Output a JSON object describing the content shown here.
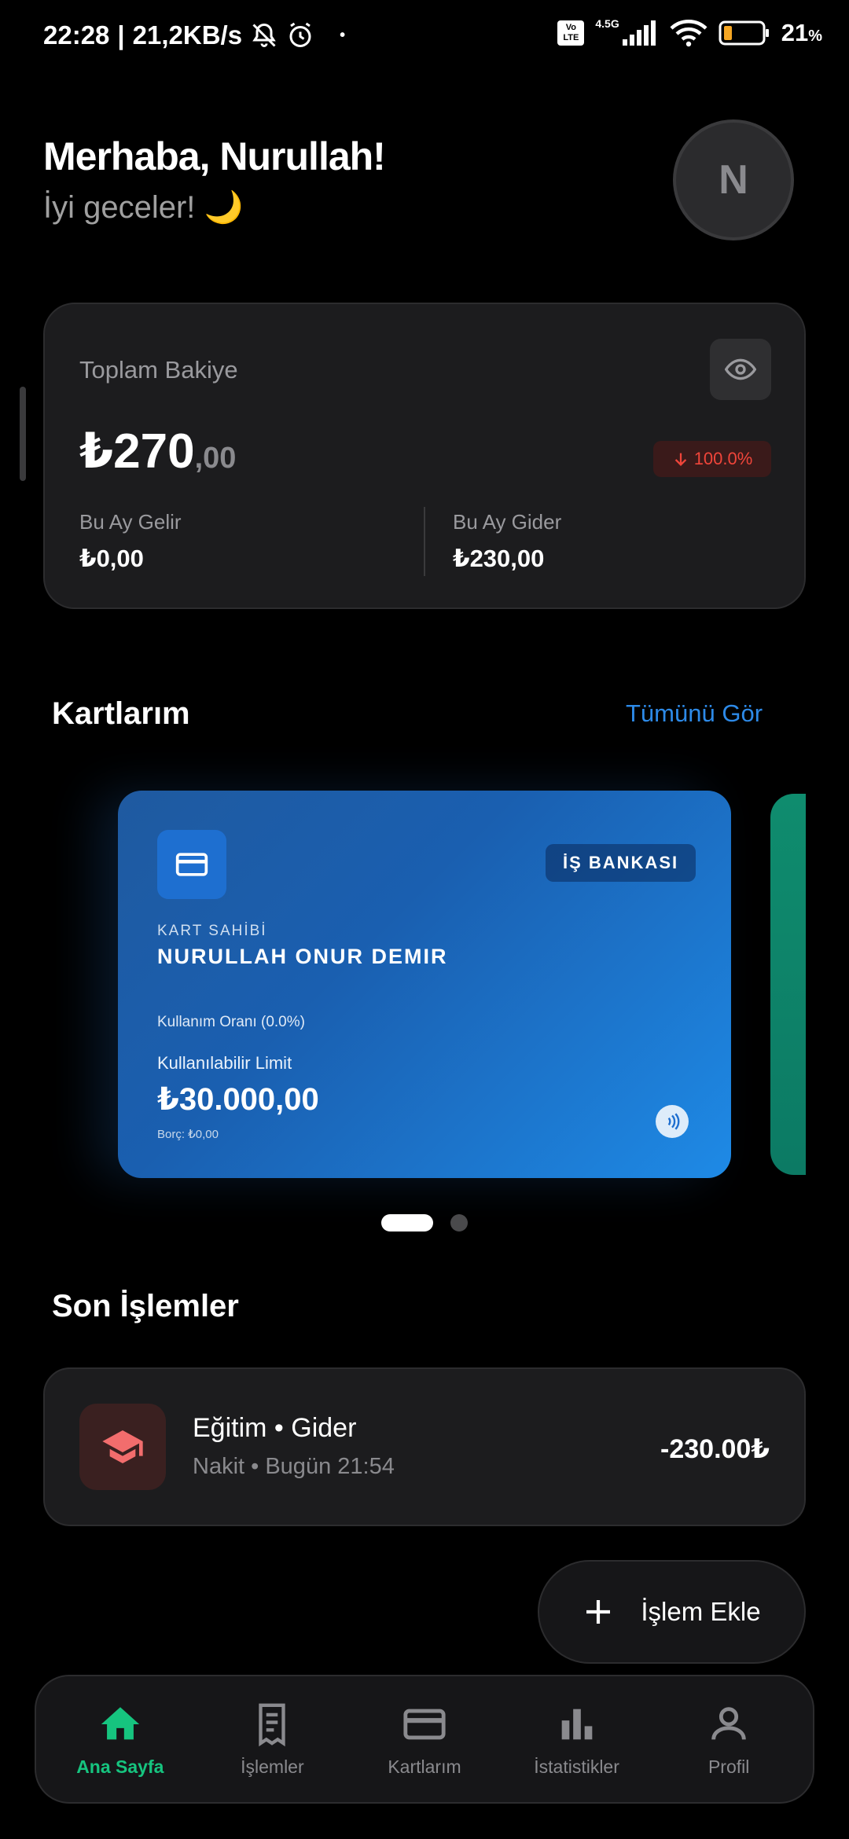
{
  "status_bar": {
    "time": "22:28",
    "speed": "21,2KB/s",
    "volte": "Vo LTE",
    "network": "4.5G",
    "battery": "21",
    "battery_unit": "%"
  },
  "header": {
    "greeting": "Merhaba, Nurullah!",
    "subtitle": "İyi geceler! 🌙",
    "avatar_initial": "N"
  },
  "balance": {
    "label": "Toplam Bakiye",
    "amount_main": "₺270",
    "amount_decimal": ",00",
    "change": "100.0%",
    "income_label": "Bu Ay Gelir",
    "income_value": "₺0,00",
    "expense_label": "Bu Ay Gider",
    "expense_value": "₺230,00"
  },
  "cards_section": {
    "title": "Kartlarım",
    "see_all": "Tümünü Gör",
    "card": {
      "bank": "İŞ BANKASI",
      "holder_label": "KART SAHİBİ",
      "holder_name": "NURULLAH ONUR DEMIR",
      "usage": "Kullanım Oranı (0.0%)",
      "limit_label": "Kullanılabilir Limit",
      "limit_value": "₺30.000,00",
      "debt": "Borç: ₺0,00"
    }
  },
  "transactions": {
    "title": "Son İşlemler",
    "items": [
      {
        "title": "Eğitim • Gider",
        "subtitle": "Nakit • Bugün 21:54",
        "amount": "-230.00₺"
      }
    ]
  },
  "fab": {
    "label": "İşlem Ekle"
  },
  "nav": {
    "items": [
      {
        "label": "Ana Sayfa",
        "icon": "home-icon"
      },
      {
        "label": "İşlemler",
        "icon": "receipt-icon"
      },
      {
        "label": "Kartlarım",
        "icon": "credit-card-icon"
      },
      {
        "label": "İstatistikler",
        "icon": "bar-chart-icon"
      },
      {
        "label": "Profil",
        "icon": "person-icon"
      }
    ]
  },
  "colors": {
    "accent_green": "#16c47f",
    "link_blue": "#2d8ae8",
    "negative_red": "#f0453a",
    "card_blue": "#1e6fd0"
  }
}
